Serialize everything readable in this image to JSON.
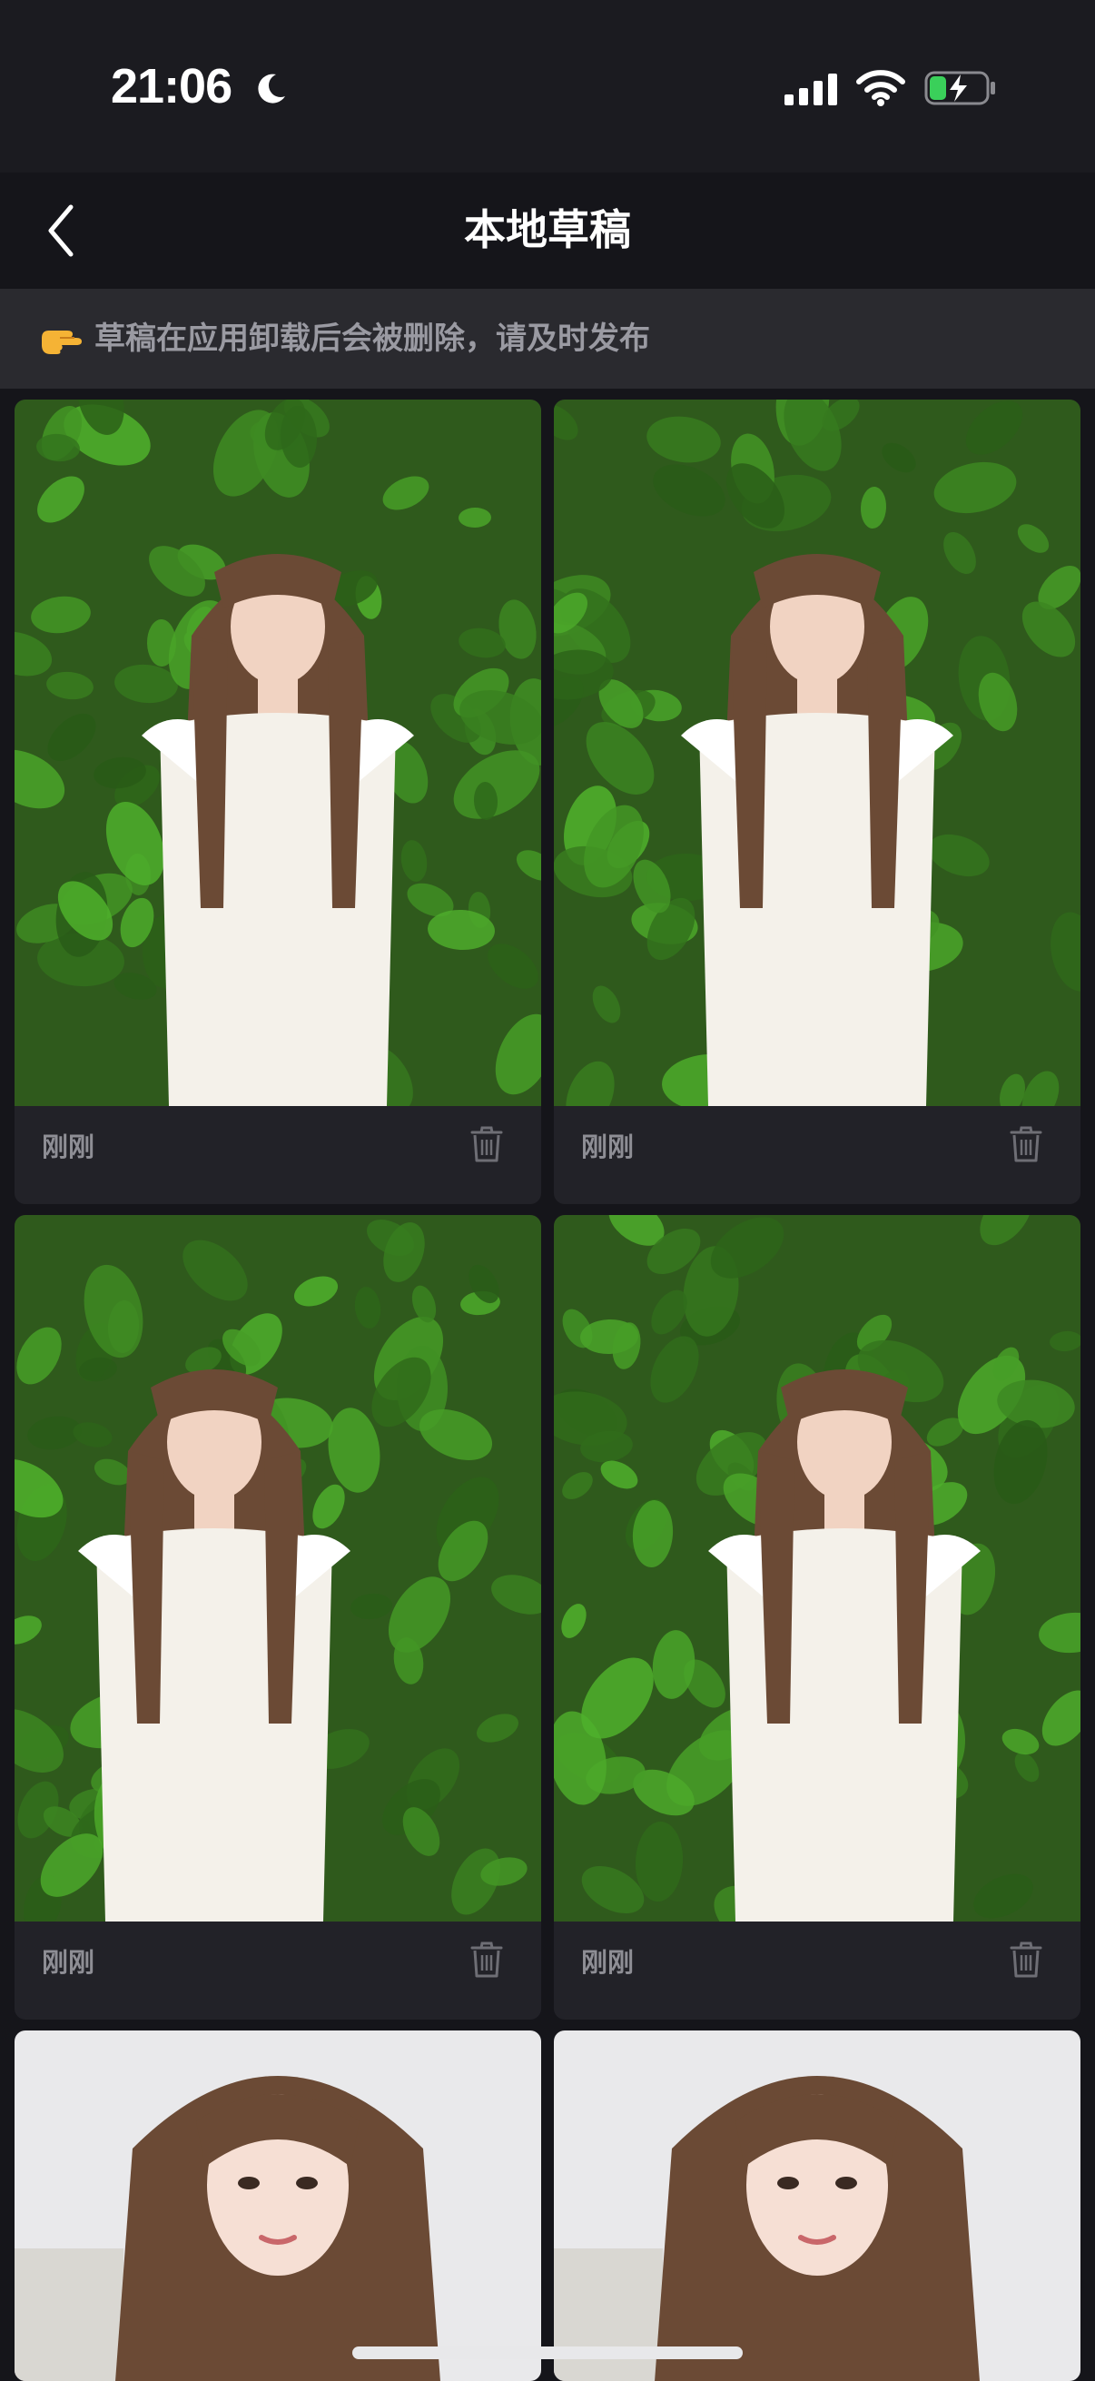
{
  "status_bar": {
    "time": "21:06"
  },
  "nav": {
    "title": "本地草稿"
  },
  "notice": {
    "emoji": "👉",
    "text": "草稿在应用卸载后会被删除，请及时发布"
  },
  "drafts": [
    {
      "time_label": "刚刚",
      "photo": "woman-white-dress-holding-leaf"
    },
    {
      "time_label": "刚刚",
      "photo": "woman-white-dress-standing"
    },
    {
      "time_label": "刚刚",
      "photo": "woman-white-dress-hand-on-head"
    },
    {
      "time_label": "刚刚",
      "photo": "woman-white-dress-hands-clasped"
    },
    {
      "time_label": "",
      "photo": "woman-portrait-white-wall"
    },
    {
      "time_label": "",
      "photo": "woman-portrait-white-wall"
    }
  ],
  "colors": {
    "background": "#15151a",
    "card": "#222228",
    "notice_bg": "#2a2a2f",
    "muted_text": "#8e8e95",
    "foliage": "#3d6b23",
    "dress": "#f4f1ea",
    "hair": "#6b4a35"
  }
}
